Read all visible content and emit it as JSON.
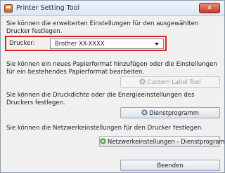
{
  "window": {
    "title": "Printer Setting Tool",
    "close_icon": "close-x-icon",
    "app_icon": "printer-tool-icon"
  },
  "printer_section": {
    "description": "Sie können die erweiterten Einstellungen für den ausgewählten Drucker festlegen.",
    "label": "Drucker:",
    "selected": "Brother XX-XXXX",
    "highlight_color": "#e0201a"
  },
  "custom_label_section": {
    "description": "Sie können ein neues Papierformat hinzufügen oder die Einstellungen für ein bestehendes Papierformat bearbeiten.",
    "button_label": "Custom Label Tool",
    "button_icon": "custom-label-tool-icon"
  },
  "utility_section": {
    "description": "Sie können die Druckdichte oder die Energieeinstellungen des Druckers festlegen.",
    "button_label": "Dienstprogramm",
    "button_icon": "utility-tool-icon"
  },
  "network_section": {
    "description": "Sie können die Netzwerkeinstellungen für den Drucker festlegen.",
    "button_label": "Netzwerkeinstellungen - Dienstprogramm",
    "button_icon": "network-tool-icon"
  },
  "footer": {
    "exit_label": "Beenden"
  }
}
